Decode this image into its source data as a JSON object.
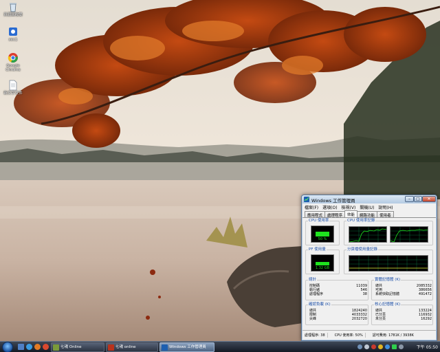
{
  "desktop": {
    "icons": [
      {
        "label": "資源回收筒",
        "icon": "recycle-bin-icon"
      },
      {
        "label": "sec1",
        "icon": "program-icon"
      },
      {
        "label": "Google Chrome",
        "icon": "chrome-icon"
      },
      {
        "label": "新文字文件",
        "icon": "text-document-icon"
      }
    ]
  },
  "task_manager": {
    "title": "Windows 工作管理員",
    "controls": {
      "minimize": "–",
      "maximize": "□",
      "close": "✕"
    },
    "menu": [
      "檔案(F)",
      "選項(O)",
      "檢視(V)",
      "關機(U)",
      "說明(H)"
    ],
    "tabs": [
      "應用程式",
      "處理程序",
      "效能",
      "網路功能",
      "使用者"
    ],
    "active_tab": "效能",
    "cpu_usage": {
      "label": "CPU 使用率",
      "value_text": "50 %",
      "percent": 50
    },
    "cpu_history": {
      "label": "CPU 使用率記錄"
    },
    "pf_usage": {
      "label": "PF 使用量",
      "value_text": "1.32 GB",
      "fraction": 0.33
    },
    "pf_history": {
      "label": "分頁檔使用量記錄"
    },
    "totals": {
      "label": "總計",
      "rows": [
        {
          "name": "控制碼",
          "value": "11039"
        },
        {
          "name": "執行緒",
          "value": "546"
        },
        {
          "name": "處理程序",
          "value": "38"
        }
      ]
    },
    "physical_memory": {
      "label": "實體記憶體 (K)",
      "rows": [
        {
          "name": "總共",
          "value": "2085332"
        },
        {
          "name": "可用",
          "value": "386656"
        },
        {
          "name": "系統快取記憶體",
          "value": "491472"
        }
      ]
    },
    "commit_charge": {
      "label": "確認負載 (K)",
      "rows": [
        {
          "name": "總共",
          "value": "1824240"
        },
        {
          "name": "限制",
          "value": "4033332"
        },
        {
          "name": "尖峰",
          "value": "2032720"
        }
      ]
    },
    "kernel_memory": {
      "label": "核心記憶體 (K)",
      "rows": [
        {
          "name": "總共",
          "value": "133224"
        },
        {
          "name": "已分頁",
          "value": "116932"
        },
        {
          "name": "未分頁",
          "value": "16292"
        }
      ]
    },
    "status": {
      "processes": "處理程序: 38",
      "cpu": "CPU 使用率: 50%",
      "commit": "認可費用: 1781K / 3938K"
    }
  },
  "taskbar": {
    "tasks": [
      {
        "label": "七魂 Online",
        "active": false
      },
      {
        "label": "七魂 online",
        "active": false
      },
      {
        "label": "Windows 工作管理員",
        "active": true
      }
    ],
    "clock": "下午 05:50"
  },
  "colors": {
    "graph_green": "#1ee31e",
    "grid_green": "#0b6b3a",
    "title_blue": "#1c4fa8",
    "taskbar_dark": "#141a24"
  }
}
